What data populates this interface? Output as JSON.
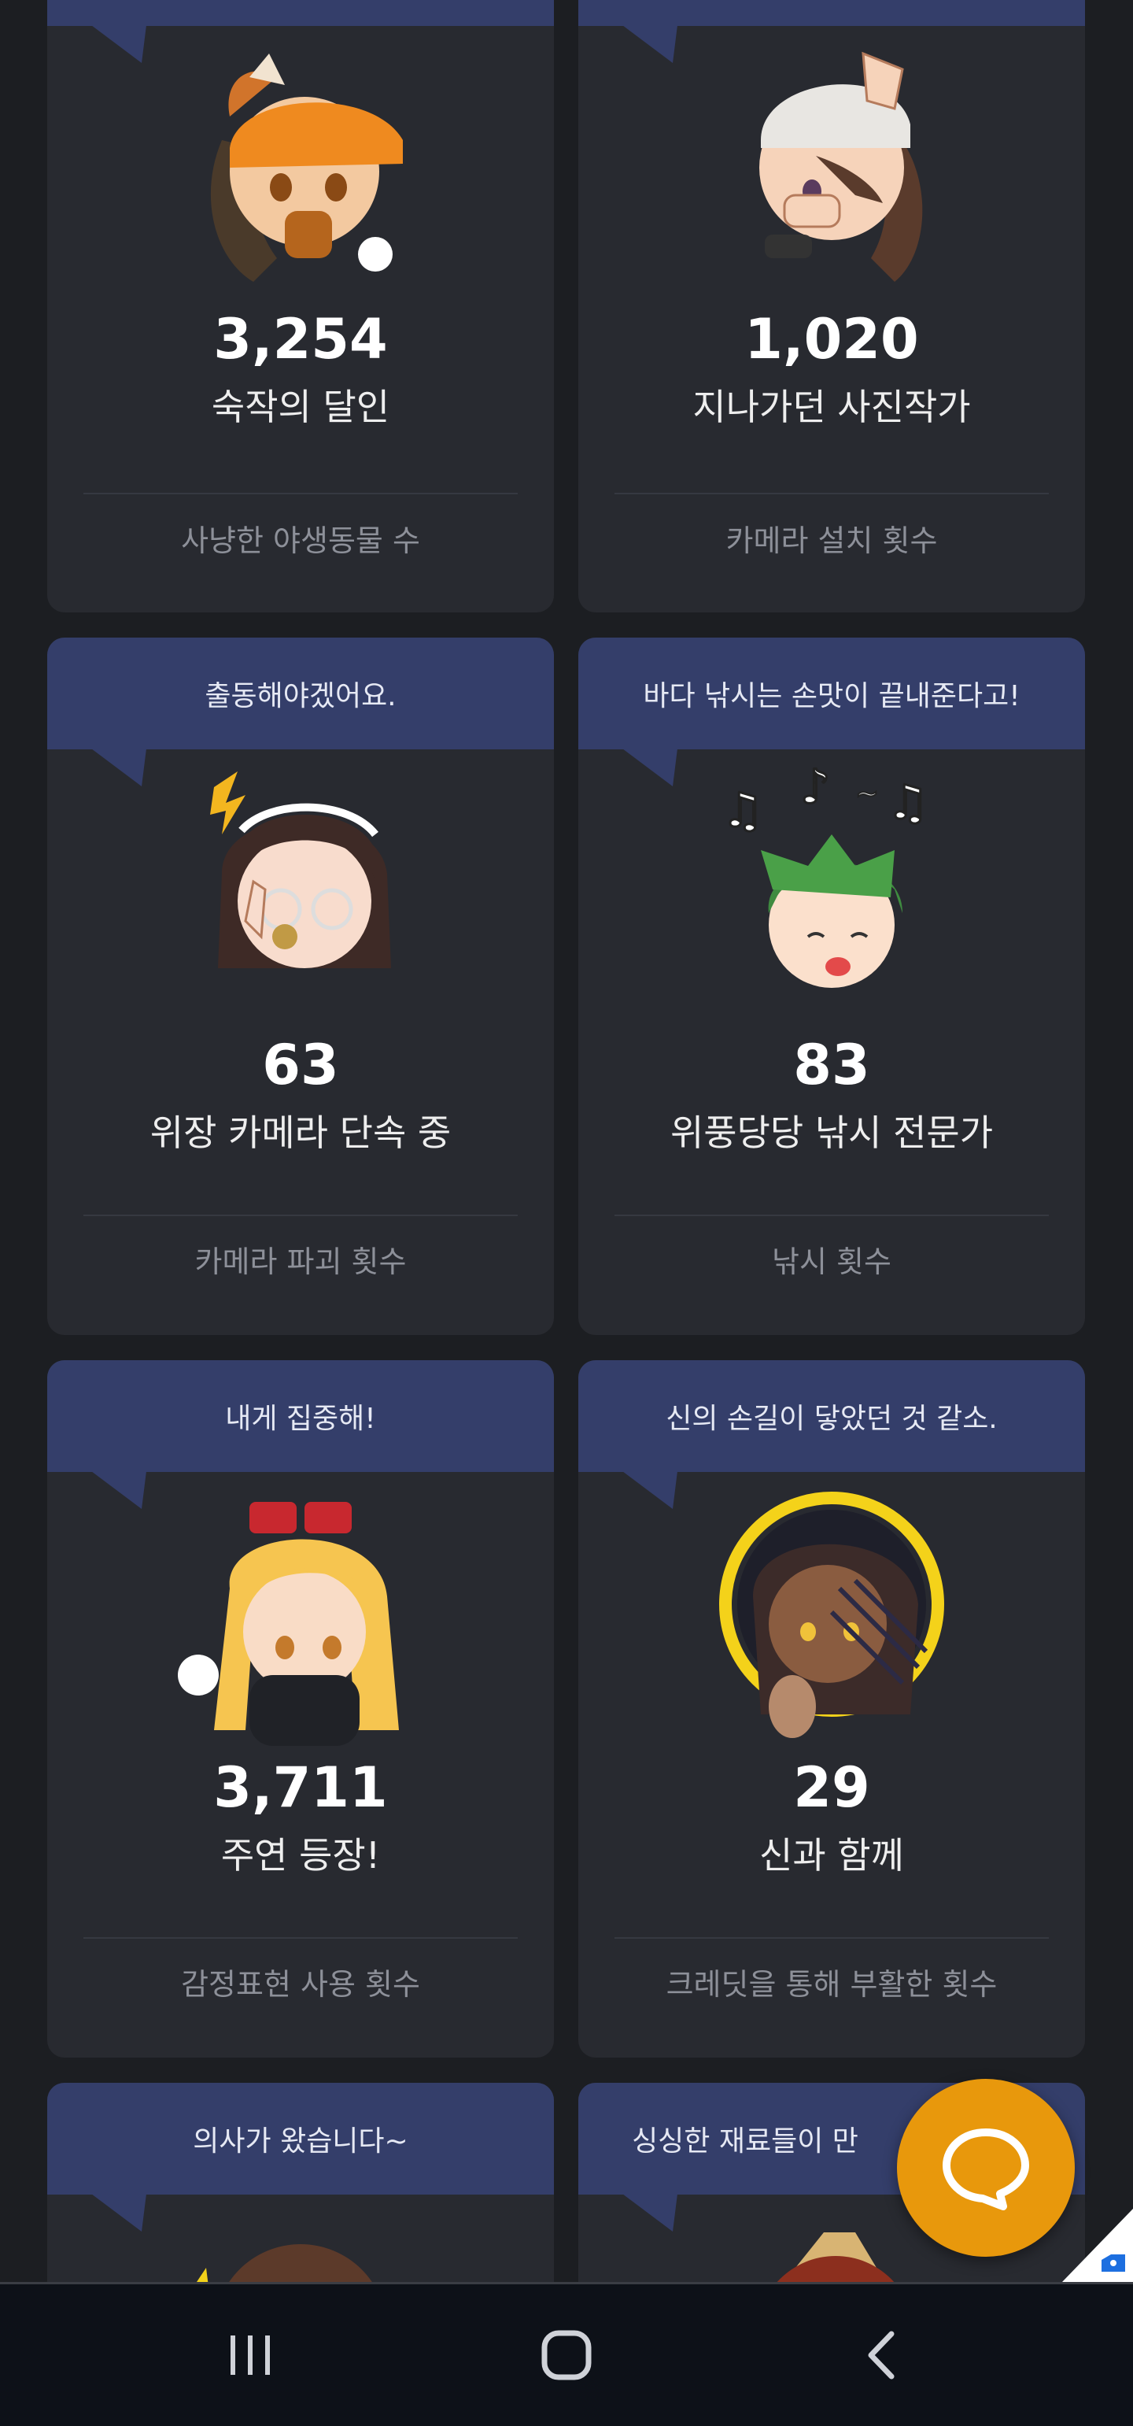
{
  "cards": [
    {
      "speech": "",
      "value": "3,254",
      "title": "숙작의 달인",
      "label": "사냥한 야생동물 수",
      "avatar": "fox-hat-character-icon"
    },
    {
      "speech": "",
      "value": "1,020",
      "title": "지나가던 사진작가",
      "label": "카메라 설치 횟수",
      "avatar": "photographer-character-icon"
    },
    {
      "speech": "출동해야겠어요.",
      "value": "63",
      "title": "위장 카메라 단속 중",
      "label": "카메라 파괴 횟수",
      "avatar": "whistle-girl-character-icon"
    },
    {
      "speech": "바다 낚시는 손맛이 끝내준다고!",
      "value": "83",
      "title": "위풍당당 낚시 전문가",
      "label": "낚시 횟수",
      "avatar": "singing-boy-character-icon"
    },
    {
      "speech": "내게 집중해!",
      "value": "3,711",
      "title": "주연 등장!",
      "label": "감정표현 사용 횟수",
      "avatar": "blonde-sunglasses-character-icon"
    },
    {
      "speech": "신의 손길이 닿았던 것 같소.",
      "value": "29",
      "title": "신과 함께",
      "label": "크레딧을 통해 부활한 횟수",
      "avatar": "halo-character-icon"
    },
    {
      "speech": "의사가 왔습니다~",
      "value": "",
      "title": "",
      "label": "",
      "avatar": "doctor-character-icon"
    },
    {
      "speech": "싱싱한 재료들이 만",
      "value": "",
      "title": "",
      "label": "",
      "avatar": "chef-character-icon"
    }
  ],
  "colors": {
    "background": "#1c1e22",
    "card": "#282a30",
    "speech": "#343e6a",
    "fab": "#e8980c",
    "navbar": "#0d1118"
  },
  "fab": {
    "icon": "chat-bubble-icon"
  },
  "navbar": {
    "recent_icon": "recent-apps-icon",
    "home_icon": "home-icon",
    "back_icon": "back-icon"
  }
}
